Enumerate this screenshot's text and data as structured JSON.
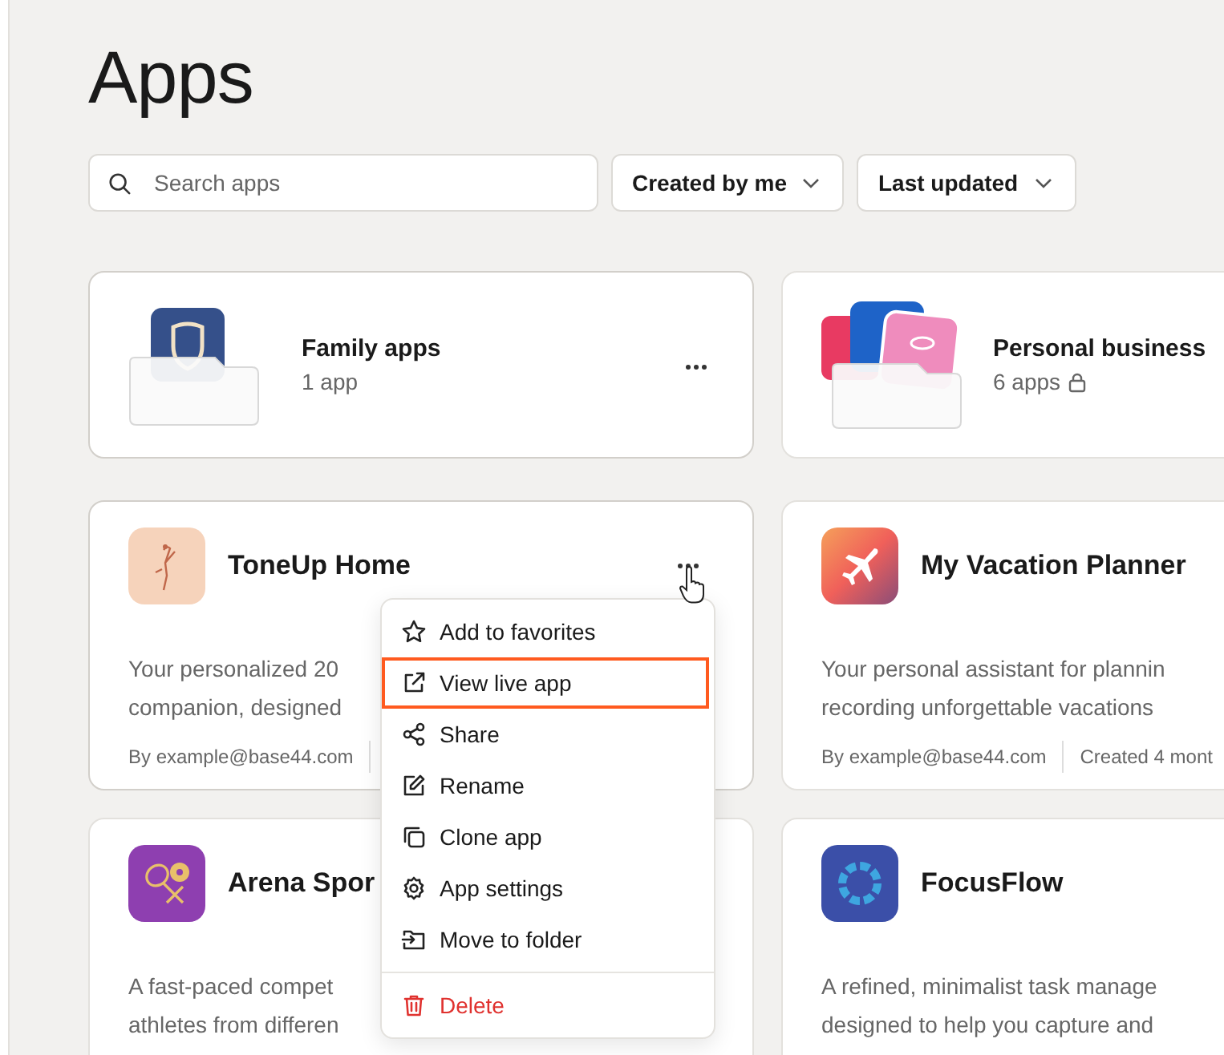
{
  "page_title": "Apps",
  "search": {
    "placeholder": "Search apps"
  },
  "filters": [
    {
      "label": "Created by me"
    },
    {
      "label": "Last updated"
    }
  ],
  "folders": [
    {
      "name": "Family apps",
      "count": "1 app",
      "locked": false,
      "menu_button": true
    },
    {
      "name": "Personal business",
      "count": "6 apps",
      "locked": true,
      "menu_button": false
    }
  ],
  "apps": [
    {
      "name": "ToneUp Home",
      "description": [
        "Your personalized 20",
        "companion, designed"
      ],
      "author": "By example@base44.com",
      "menu_button": true
    },
    {
      "name": "My Vacation Planner",
      "description": [
        "Your personal assistant for plannin",
        "recording unforgettable vacations"
      ],
      "author": "By example@base44.com",
      "created": "Created 4 mont",
      "menu_button": false
    },
    {
      "name": "Arena Spor",
      "description": [
        "A fast-paced compet",
        "athletes from differen"
      ],
      "menu_button": false
    },
    {
      "name": "FocusFlow",
      "description": [
        "A refined, minimalist task manage",
        "designed to help you capture and"
      ],
      "menu_button": false
    }
  ],
  "context_menu": {
    "items": [
      {
        "label": "Add to favorites",
        "kind": "normal",
        "highlighted": false
      },
      {
        "label": "View live app",
        "kind": "normal",
        "highlighted": true
      },
      {
        "label": "Share",
        "kind": "normal",
        "highlighted": false
      },
      {
        "label": "Rename",
        "kind": "normal",
        "highlighted": false
      },
      {
        "label": "Clone app",
        "kind": "normal",
        "highlighted": false
      },
      {
        "label": "App settings",
        "kind": "normal",
        "highlighted": false
      },
      {
        "label": "Move to folder",
        "kind": "normal",
        "highlighted": false
      },
      {
        "label": "Delete",
        "kind": "danger",
        "highlighted": false
      }
    ]
  }
}
